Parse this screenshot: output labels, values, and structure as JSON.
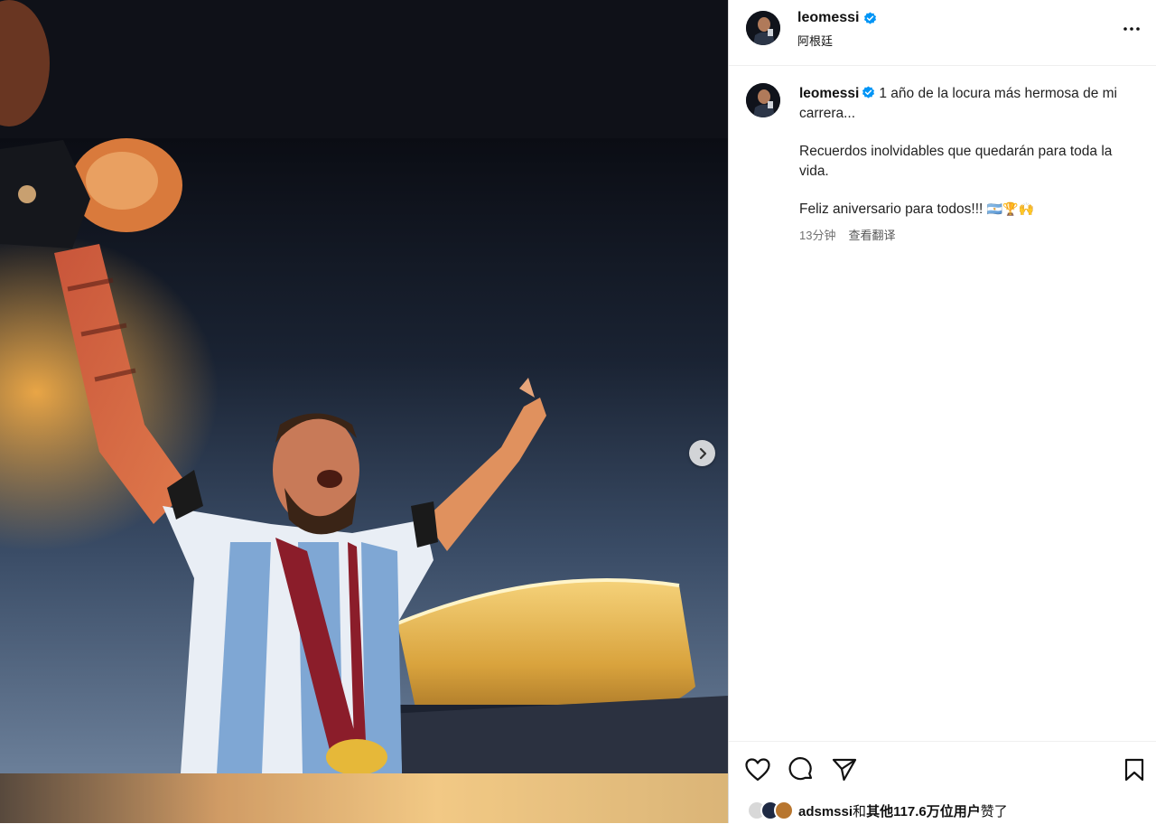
{
  "post": {
    "username": "leomessi",
    "location": "阿根廷",
    "more_icon": "more-horizontal-icon",
    "verified_icon": "verified-badge-icon"
  },
  "caption": {
    "username": "leomessi",
    "line1": "1 año de la locura más hermosa de mi carrera...",
    "line2": "Recuerdos inolvidables que quedarán para toda la vida.",
    "line3": "Feliz aniversario para todos!!!",
    "emojis": "🇦🇷🏆🙌",
    "time": "13分钟",
    "translate": "查看翻译"
  },
  "actions": {
    "like_icon": "heart-icon",
    "comment_icon": "comment-icon",
    "share_icon": "share-icon",
    "save_icon": "bookmark-icon"
  },
  "likes": {
    "user": "adsmssi",
    "and": "和",
    "others": "其他117.6万位用户",
    "suffix": "赞了"
  },
  "media": {
    "next_icon": "chevron-right-icon"
  }
}
